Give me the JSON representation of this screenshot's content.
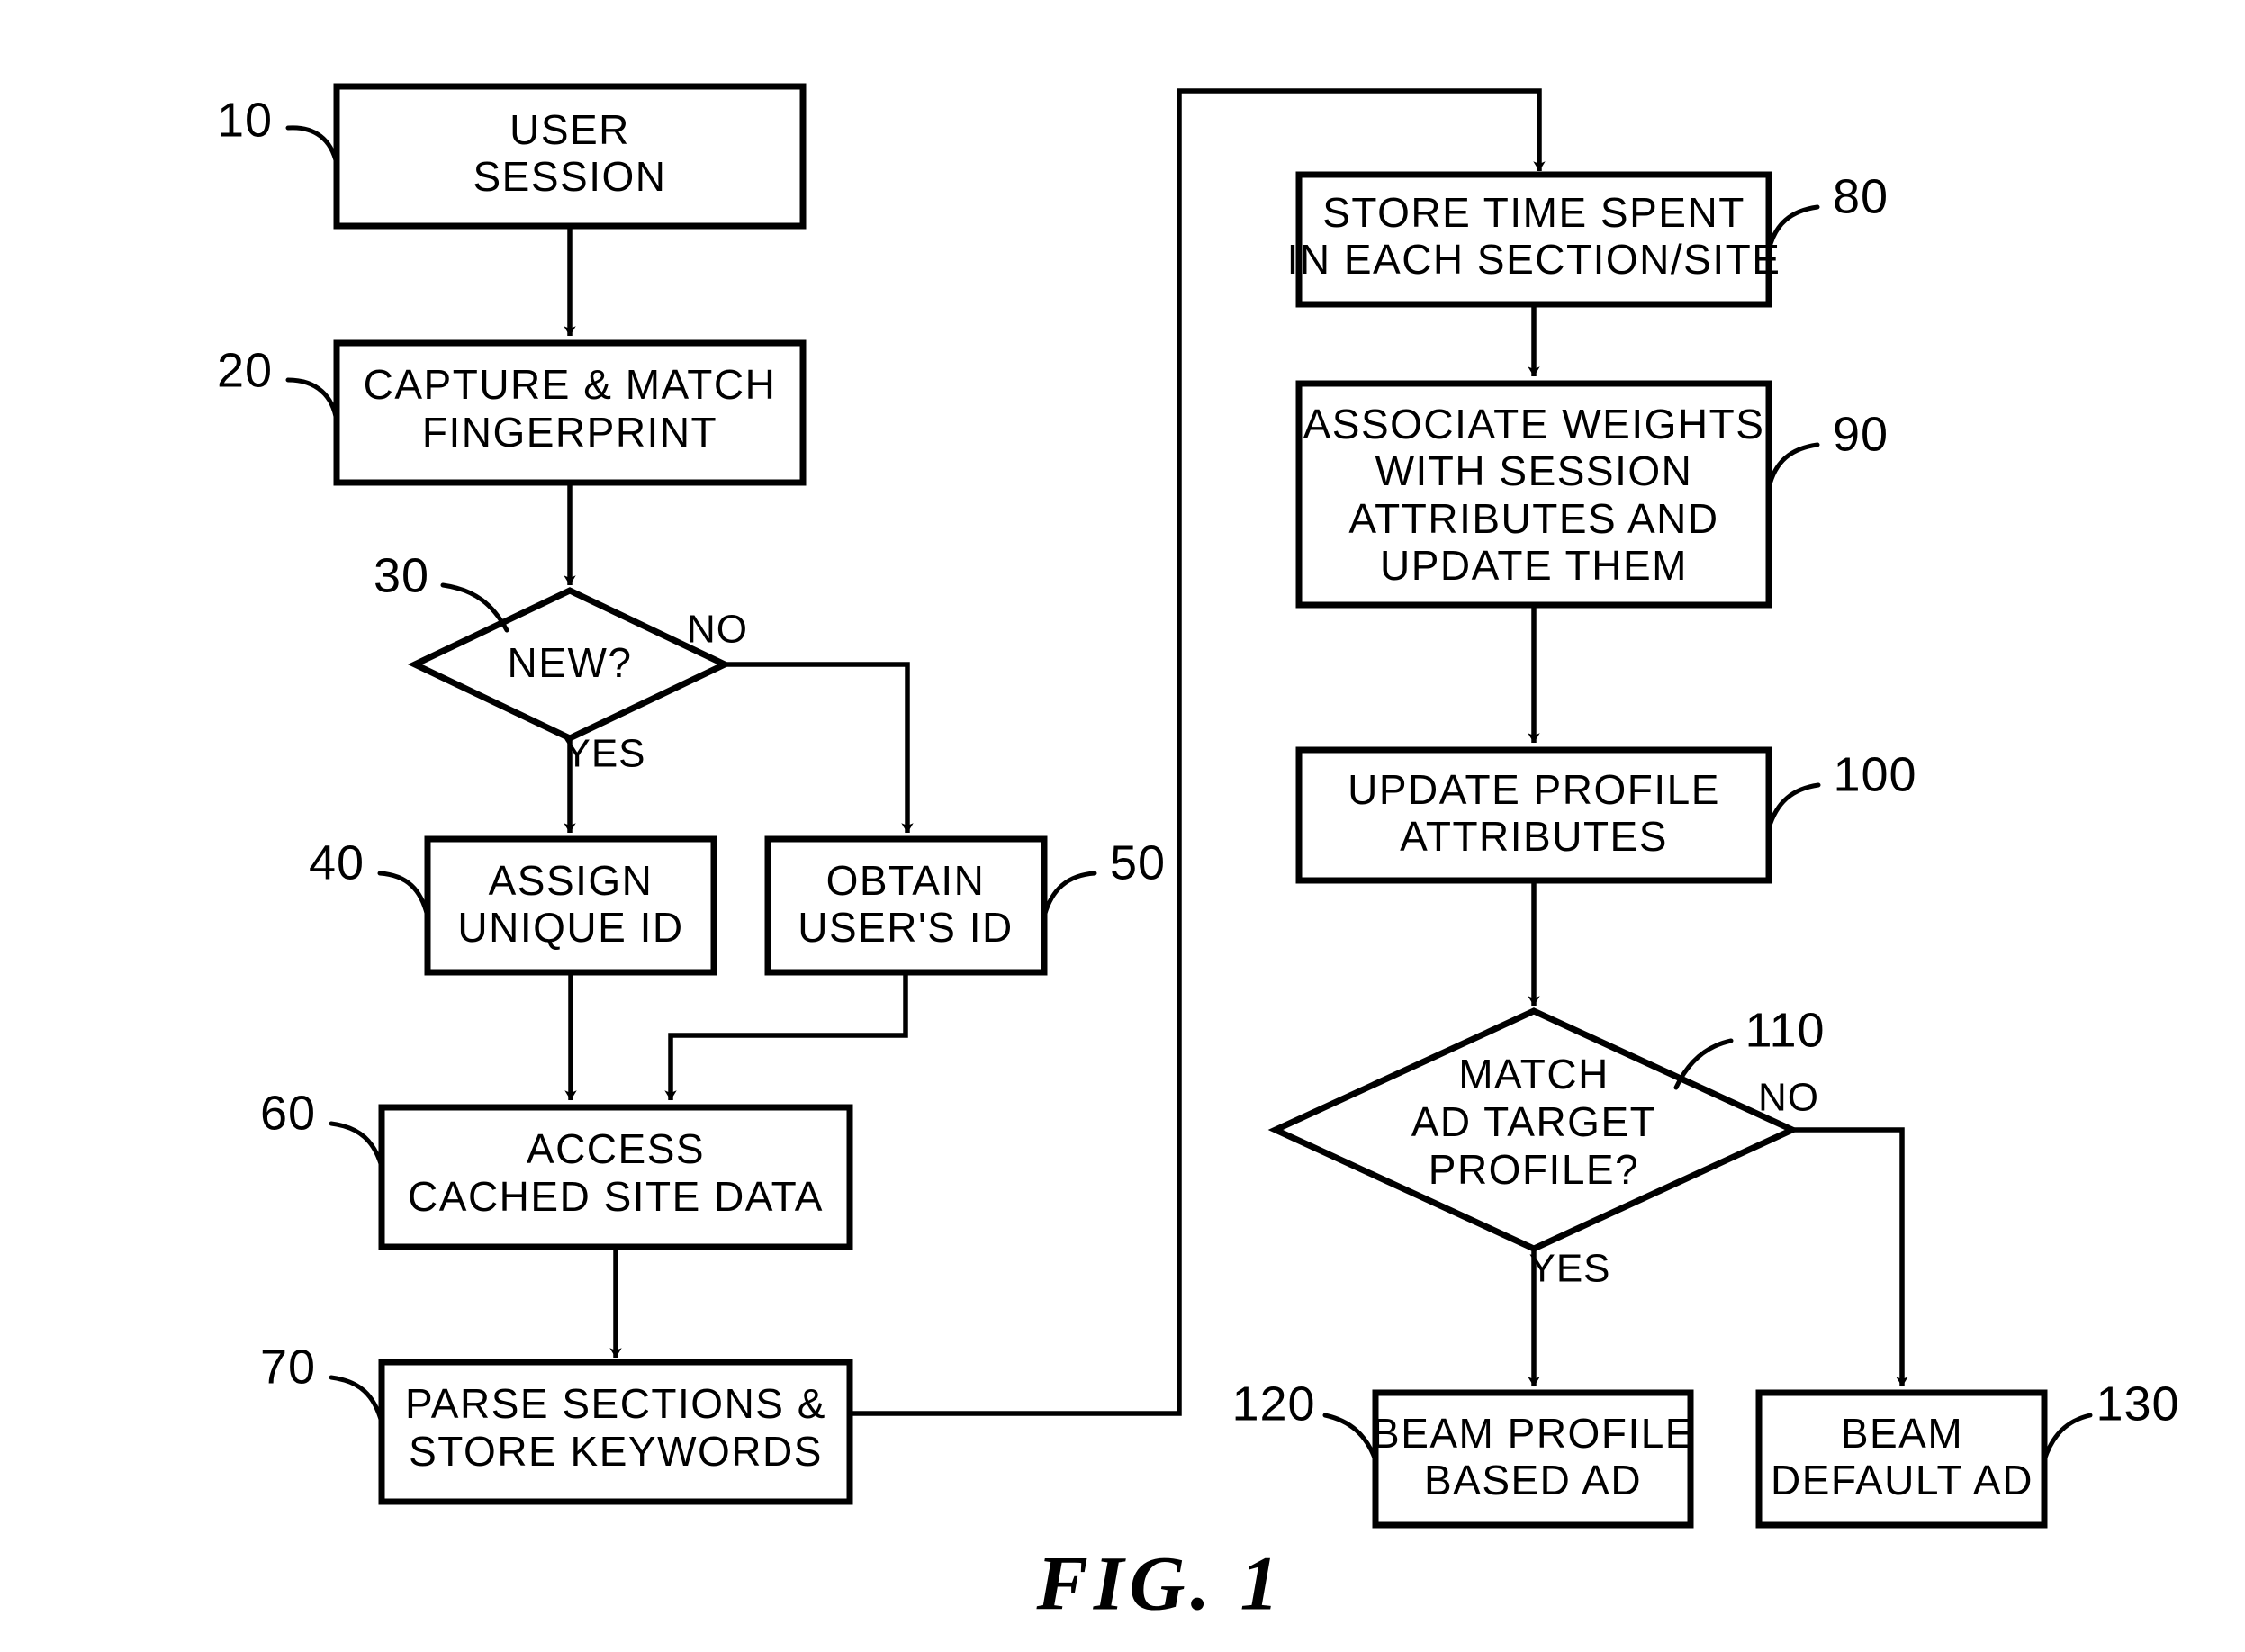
{
  "figure": {
    "caption": "FIG. 1",
    "type": "patent-flowchart"
  },
  "nodes": {
    "user_session": {
      "ref": "10",
      "shape": "process",
      "lines": [
        "USER",
        "SESSION"
      ]
    },
    "capture_match_fingerprint": {
      "ref": "20",
      "shape": "process",
      "lines": [
        "CAPTURE  &  MATCH",
        "FINGERPRINT"
      ]
    },
    "new_decision": {
      "ref": "30",
      "shape": "decision",
      "lines": [
        "NEW?"
      ]
    },
    "assign_unique_id": {
      "ref": "40",
      "shape": "process",
      "lines": [
        "ASSIGN",
        "UNIQUE  ID"
      ]
    },
    "obtain_users_id": {
      "ref": "50",
      "shape": "process",
      "lines": [
        "OBTAIN",
        "USER'S  ID"
      ]
    },
    "access_cached_site_data": {
      "ref": "60",
      "shape": "process",
      "lines": [
        "ACCESS",
        "CACHED  SITE  DATA"
      ]
    },
    "parse_sections_store_keywords": {
      "ref": "70",
      "shape": "process",
      "lines": [
        "PARSE  SECTIONS  &",
        "STORE  KEYWORDS"
      ]
    },
    "store_time_spent": {
      "ref": "80",
      "shape": "process",
      "lines": [
        "STORE TIME SPENT",
        "IN  EACH  SECTION/SITE"
      ]
    },
    "associate_weights": {
      "ref": "90",
      "shape": "process",
      "lines": [
        "ASSOCIATE  WEIGHTS",
        "WITH  SESSION",
        "ATTRIBUTES  AND",
        "UPDATE  THEM"
      ]
    },
    "update_profile_attributes": {
      "ref": "100",
      "shape": "process",
      "lines": [
        "UPDATE  PROFILE",
        "ATTRIBUTES"
      ]
    },
    "match_ad_target_profile": {
      "ref": "110",
      "shape": "decision",
      "lines": [
        "MATCH",
        "AD  TARGET",
        "PROFILE?"
      ]
    },
    "beam_profile_based_ad": {
      "ref": "120",
      "shape": "process",
      "lines": [
        "BEAM PROFILE",
        "BASED AD"
      ]
    },
    "beam_default_ad": {
      "ref": "130",
      "shape": "process",
      "lines": [
        "BEAM",
        "DEFAULT AD"
      ]
    }
  },
  "edge_labels": {
    "new_no": "NO",
    "new_yes": "YES",
    "match_no": "NO",
    "match_yes": "YES"
  },
  "colors": {
    "ink": "#000000",
    "paper": "#ffffff"
  }
}
